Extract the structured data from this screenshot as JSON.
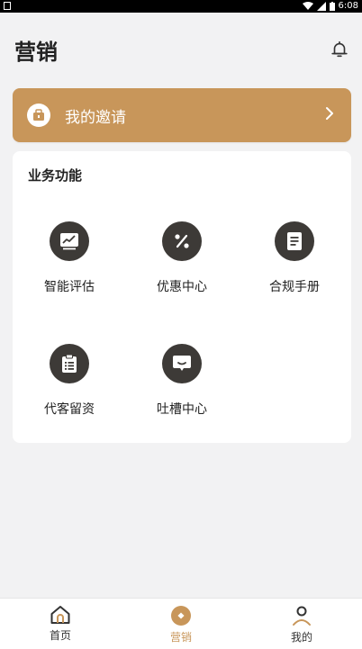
{
  "status": {
    "time": "6:08"
  },
  "header": {
    "title": "营销"
  },
  "invite": {
    "label": "我的邀请"
  },
  "section": {
    "title": "业务功能"
  },
  "features": [
    {
      "label": "智能评估",
      "icon": "chart-icon"
    },
    {
      "label": "优惠中心",
      "icon": "percent-icon"
    },
    {
      "label": "合规手册",
      "icon": "document-icon"
    },
    {
      "label": "代客留资",
      "icon": "clipboard-icon"
    },
    {
      "label": "吐槽中心",
      "icon": "chat-icon"
    }
  ],
  "tabs": [
    {
      "label": "首页",
      "icon": "home-icon",
      "active": false
    },
    {
      "label": "营销",
      "icon": "marketing-icon",
      "active": true
    },
    {
      "label": "我的",
      "icon": "user-icon",
      "active": false
    }
  ],
  "colors": {
    "accent": "#c8965a",
    "icon_bg": "#3d3a37",
    "background": "#f2f2f3"
  }
}
